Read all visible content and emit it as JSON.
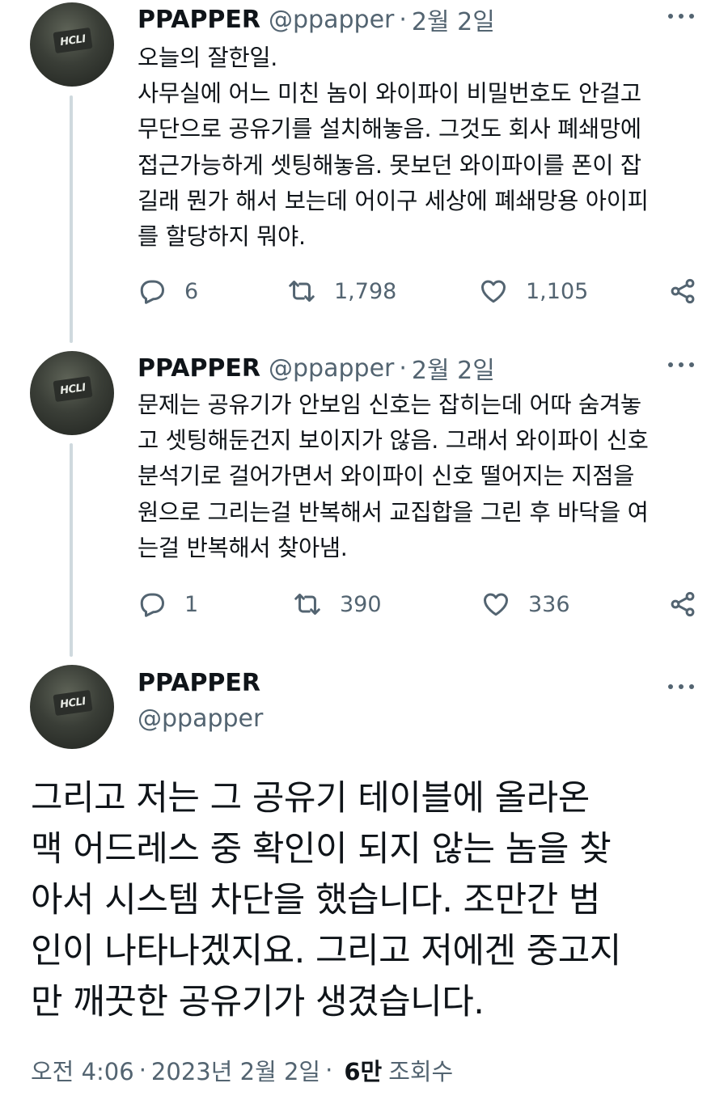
{
  "tweets": [
    {
      "name": "PPAPPER",
      "handle": "@ppapper",
      "separator": "·",
      "date": "2월 2일",
      "text": "오늘의 잘한일.\n사무실에 어느 미친 놈이 와이파이 비밀번호도 안걸고\n무단으로 공유기를 설치해놓음. 그것도 회사 폐쇄망에\n접근가능하게 셋팅해놓음. 못보던 와이파이를 폰이 잡\n길래 뭔가 해서 보는데 어이구 세상에 폐쇄망용 아이피\n를 할당하지 뭐야.",
      "replies": "6",
      "retweets": "1,798",
      "likes": "1,105"
    },
    {
      "name": "PPAPPER",
      "handle": "@ppapper",
      "separator": "·",
      "date": "2월 2일",
      "text": "문제는 공유기가 안보임 신호는 잡히는데 어따 숨겨놓\n고 셋팅해둔건지 보이지가 않음. 그래서 와이파이 신호\n분석기로 걸어가면서 와이파이 신호 떨어지는 지점을\n원으로 그리는걸 반복해서 교집합을 그린 후 바닥을 여\n는걸 반복해서 찾아냄.",
      "replies": "1",
      "retweets": "390",
      "likes": "336"
    }
  ],
  "main_tweet": {
    "name": "PPAPPER",
    "handle": "@ppapper",
    "text": "그리고 저는 그 공유기 테이블에 올라온\n맥 어드레스 중 확인이 되지 않는 놈을 찾\n아서 시스템 차단을 했습니다. 조만간 범\n인이 나타나겠지요. 그리고 저에겐 중고지\n만 깨끗한 공유기가 생겼습니다.",
    "time": "오전 4:06",
    "separator": "·",
    "date": "2023년 2월 2일",
    "views_separator": "·",
    "views_count": "6만",
    "views_label": "조회수"
  },
  "avatar": {
    "patch_text": "HCLI"
  },
  "colors": {
    "text": "#0f1419",
    "secondary": "#536471",
    "thread_line": "#cfd9de"
  }
}
